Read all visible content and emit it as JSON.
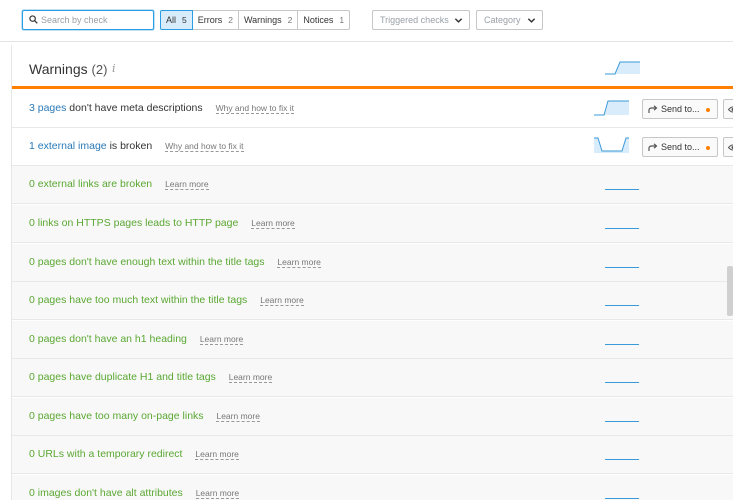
{
  "search": {
    "placeholder": "Search by check",
    "value": ""
  },
  "filters": [
    {
      "label": "All",
      "count": "5",
      "active": true
    },
    {
      "label": "Errors",
      "count": "2",
      "active": false
    },
    {
      "label": "Warnings",
      "count": "2",
      "active": false
    },
    {
      "label": "Notices",
      "count": "1",
      "active": false
    }
  ],
  "dropdowns": {
    "triggered": "Triggered checks",
    "category": "Category"
  },
  "section": {
    "title": "Warnings",
    "count": "(2)",
    "info_glyph": "i"
  },
  "action_labels": {
    "send": "Send to..."
  },
  "rows": [
    {
      "link": "3 pages",
      "text": "don't have meta descriptions",
      "help": "Why and how to fix it",
      "active": true
    },
    {
      "link": "1 external image",
      "text": "is broken",
      "help": "Why and how to fix it",
      "active": true
    },
    {
      "text": "0 external links are broken",
      "help": "Learn more"
    },
    {
      "text": "0 links on HTTPS pages leads to HTTP page",
      "help": "Learn more"
    },
    {
      "text": "0 pages don't have enough text within the title tags",
      "help": "Learn more"
    },
    {
      "text": "0 pages have too much text within the title tags",
      "help": "Learn more"
    },
    {
      "text": "0 pages don't have an h1 heading",
      "help": "Learn more"
    },
    {
      "text": "0 pages have duplicate H1 and title tags",
      "help": "Learn more"
    },
    {
      "text": "0 pages have too many on-page links",
      "help": "Learn more"
    },
    {
      "text": "0 URLs with a temporary redirect",
      "help": "Learn more"
    },
    {
      "text": "0 images don't have alt attributes",
      "help": "Learn more"
    }
  ],
  "colors": {
    "accent": "#2a9de4",
    "warning_bar": "#ff7f00",
    "zero_text": "#5aa832",
    "link": "#2a7ab8"
  }
}
